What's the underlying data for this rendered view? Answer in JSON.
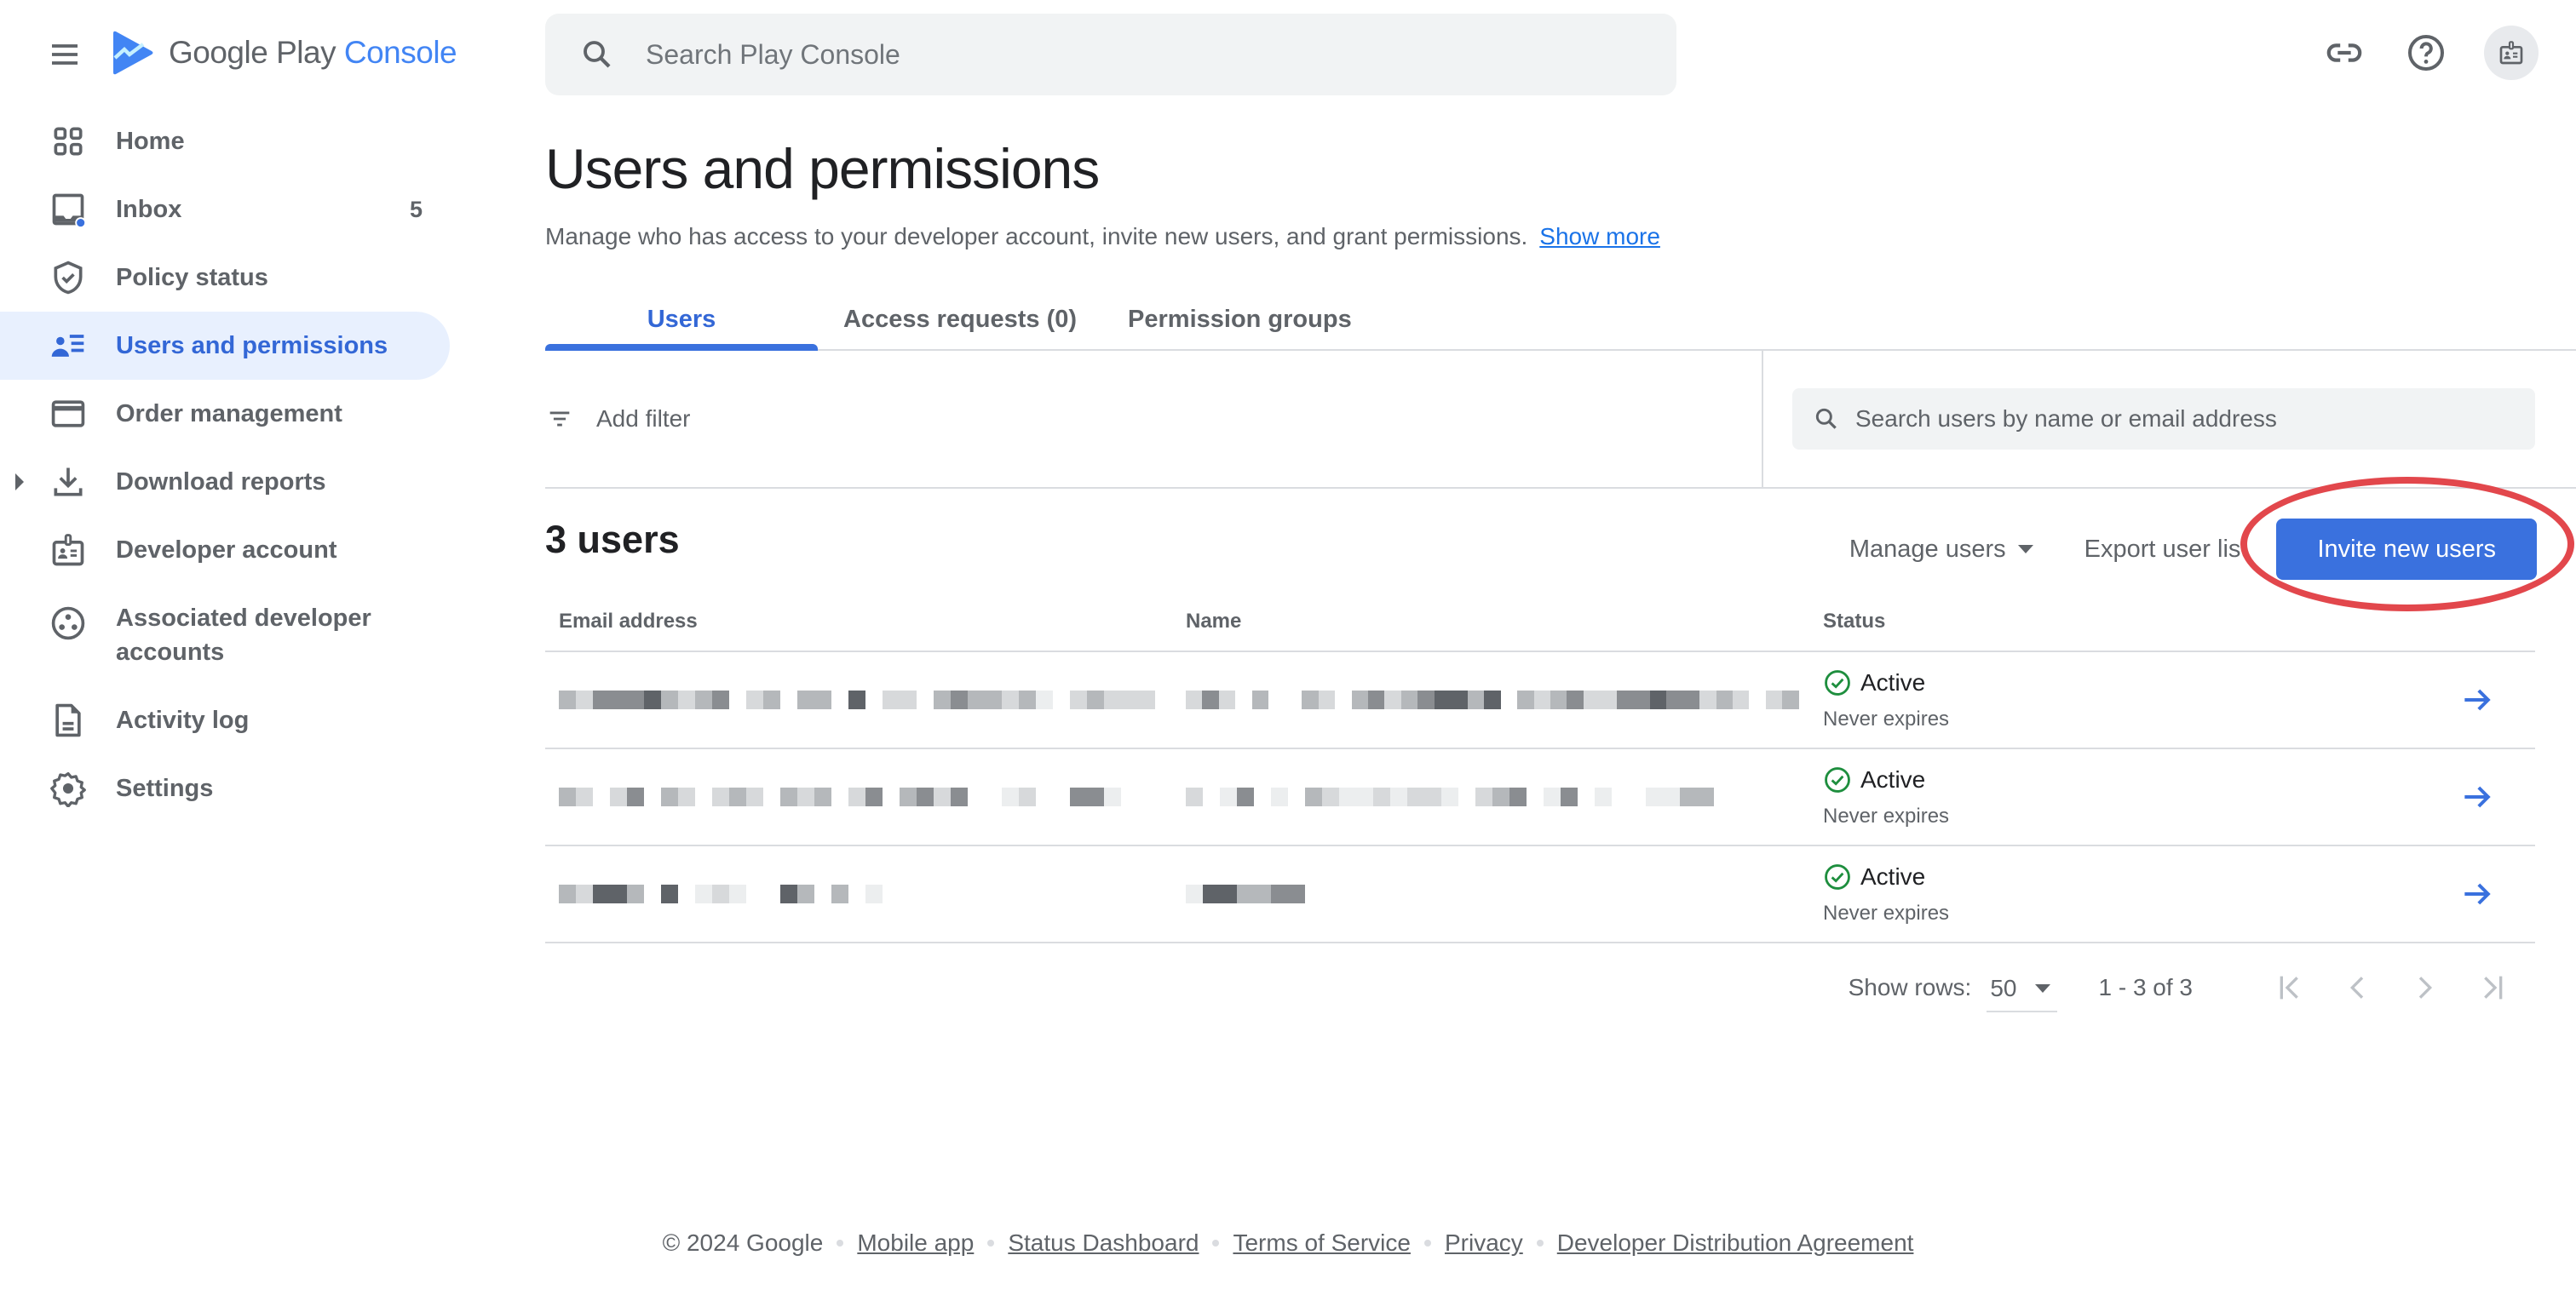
{
  "app": {
    "brand_primary": "Google Play",
    "brand_accent": "Console",
    "colors": {
      "accent": "#3a71de",
      "link": "#1a73e8",
      "active_bg": "#e8f0fe",
      "success": "#1e8e3e",
      "highlight_ring": "#e2474c"
    }
  },
  "topbar": {
    "search_placeholder": "Search Play Console",
    "icons": [
      "link-icon",
      "help-icon",
      "account-badge-icon"
    ]
  },
  "sidebar": {
    "items": [
      {
        "label": "Home",
        "icon": "home-grid-icon",
        "active": false
      },
      {
        "label": "Inbox",
        "icon": "inbox-icon",
        "badge": "5",
        "active": false
      },
      {
        "label": "Policy status",
        "icon": "shield-check-icon",
        "active": false
      },
      {
        "label": "Users and permissions",
        "icon": "users-list-icon",
        "active": true
      },
      {
        "label": "Order management",
        "icon": "credit-card-icon",
        "active": false
      },
      {
        "label": "Download reports",
        "icon": "download-icon",
        "expandable": true,
        "active": false
      },
      {
        "label": "Developer account",
        "icon": "badge-icon",
        "active": false
      },
      {
        "label": "Associated developer accounts",
        "icon": "group-circle-icon",
        "active": false
      },
      {
        "label": "Activity log",
        "icon": "document-icon",
        "active": false
      },
      {
        "label": "Settings",
        "icon": "gear-icon",
        "active": false
      }
    ]
  },
  "page": {
    "title": "Users and permissions",
    "description": "Manage who has access to your developer account, invite new users, and grant permissions.",
    "show_more": "Show more"
  },
  "tabs": [
    {
      "label": "Users",
      "active": true
    },
    {
      "label": "Access requests (0)",
      "active": false
    },
    {
      "label": "Permission groups",
      "active": false
    }
  ],
  "filter": {
    "add_filter": "Add filter",
    "search_placeholder": "Search users by name or email address"
  },
  "list": {
    "count_label": "3 users",
    "manage_users": "Manage users",
    "export": "Export user list",
    "invite": "Invite new users"
  },
  "table": {
    "columns": [
      "Email address",
      "Name",
      "Status"
    ],
    "rows": [
      {
        "email": "[redacted]",
        "name": "[redacted]",
        "status": "Active",
        "expiry": "Never expires"
      },
      {
        "email": "[redacted]",
        "name": "[redacted]",
        "status": "Active",
        "expiry": "Never expires"
      },
      {
        "email": "[redacted]",
        "name": "[redacted]",
        "status": "Active",
        "expiry": "Never expires"
      }
    ]
  },
  "pagination": {
    "show_rows_label": "Show rows:",
    "rows_per_page": "50",
    "range": "1 - 3 of 3"
  },
  "footer": {
    "copyright": "© 2024 Google",
    "links": [
      "Mobile app",
      "Status Dashboard",
      "Terms of Service",
      "Privacy",
      "Developer Distribution Agreement"
    ]
  }
}
